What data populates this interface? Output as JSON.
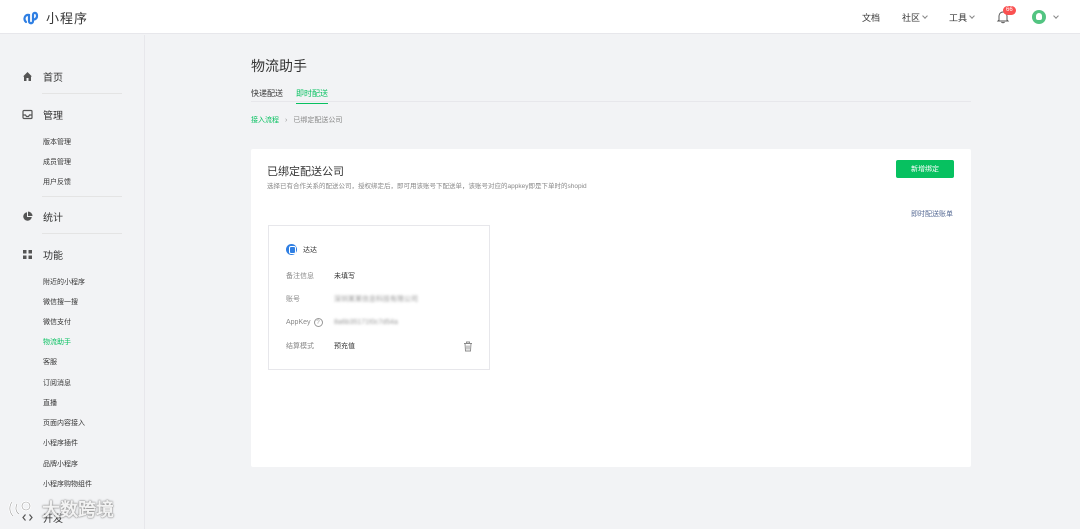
{
  "header": {
    "app_name": "小程序",
    "nav": [
      {
        "label": "文档"
      },
      {
        "label": "社区"
      },
      {
        "label": "工具"
      }
    ],
    "notification_count": "66"
  },
  "sidebar": {
    "groups": [
      {
        "label": "首页",
        "icon": "home-icon"
      },
      {
        "label": "管理",
        "icon": "inbox-icon",
        "items": [
          "版本管理",
          "成员管理",
          "用户反馈"
        ]
      },
      {
        "label": "统计",
        "icon": "pie-chart-icon"
      },
      {
        "label": "功能",
        "icon": "grid-icon",
        "items": [
          "附近的小程序",
          "微信搜一搜",
          "微信支付",
          "物流助手",
          "客服",
          "订阅消息",
          "直播",
          "页面内容接入",
          "小程序插件",
          "品牌小程序",
          "小程序购物组件"
        ]
      },
      {
        "label": "开发",
        "icon": "code-icon"
      }
    ],
    "active_item": "物流助手"
  },
  "main": {
    "title": "物流助手",
    "tabs": [
      {
        "label": "快递配送",
        "active": false
      },
      {
        "label": "即时配送",
        "active": true
      }
    ],
    "breadcrumb": {
      "link": "接入流程",
      "separator": "›",
      "current": "已绑定配送公司"
    },
    "panel": {
      "title": "已绑定配送公司",
      "description": "选择已有合作关系的配送公司，授权绑定后，即可用该账号下配送单，该账号对应的appkey即是下单时的shopid",
      "add_button": "新增绑定",
      "bill_link": "即时配送账单",
      "card": {
        "company": "达达",
        "rows": [
          {
            "label": "备注信息",
            "value": "未填写"
          },
          {
            "label": "账号",
            "value": "深圳某某信息科技有限公司"
          },
          {
            "label": "AppKey",
            "value": "8a6b35171f0c7d54a"
          },
          {
            "label": "结算模式",
            "value": "预充值"
          }
        ]
      }
    }
  },
  "watermark": "大数跨境",
  "colors": {
    "accent": "#07c160",
    "link": "#576b95",
    "badge": "#fa5151"
  }
}
